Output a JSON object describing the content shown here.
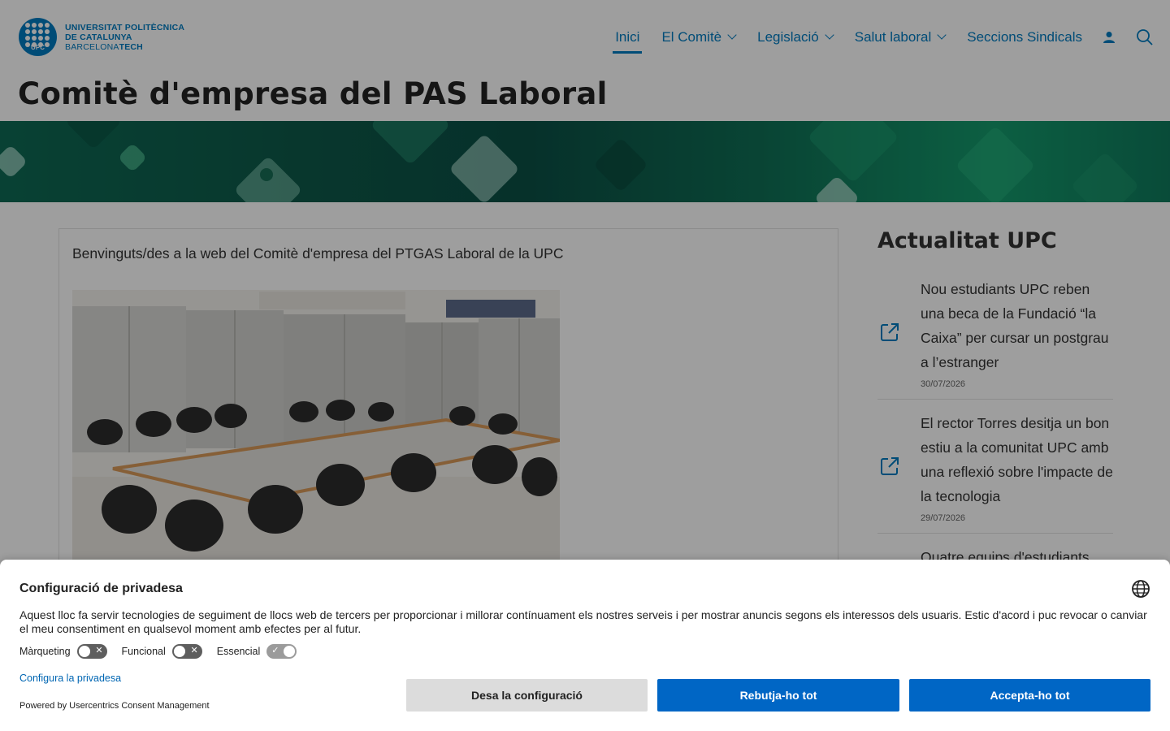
{
  "header": {
    "logo": {
      "line1": "UNIVERSITAT POLITÈCNICA",
      "line2": "DE CATALUNYA",
      "line3_light": "BARCELONA",
      "line3_bold": "TECH",
      "badge": "UPC"
    },
    "nav": [
      {
        "label": "Inici",
        "active": true,
        "dropdown": false
      },
      {
        "label": "El Comitè",
        "active": false,
        "dropdown": true
      },
      {
        "label": "Legislació",
        "active": false,
        "dropdown": true
      },
      {
        "label": "Salut laboral",
        "active": false,
        "dropdown": true
      },
      {
        "label": "Seccions Sindicals",
        "active": false,
        "dropdown": false
      }
    ],
    "icons": [
      "user-icon",
      "search-icon"
    ],
    "accent_color": "#007bc0"
  },
  "page_title": {
    "regular": "Comitè d'empresa del ",
    "bold": "PAS Laboral"
  },
  "main": {
    "intro": "Benvinguts/des a la web del Comitè d'empresa del PTGAS Laboral de la UPC"
  },
  "sidebar": {
    "title": "Actualitat UPC",
    "news": [
      {
        "title": "Nou estudiants UPC reben una beca de la Fundació “la Caixa” per cursar un postgrau a l’estranger",
        "date": "30/07/2026",
        "icon": "external-link-icon"
      },
      {
        "title": "El rector Torres desitja un bon estiu a la comunitat UPC amb una reflexió sobre l'impacte de la tecnologia",
        "date": "29/07/2026",
        "icon": "external-link-icon"
      },
      {
        "title": "Quatre equips d'estudiants",
        "date": "",
        "icon": "external-link-icon"
      }
    ]
  },
  "consent": {
    "title": "Configuració de privadesa",
    "text": "Aquest lloc fa servir tecnologies de seguiment de llocs web de tercers per proporcionar i millorar contínuament els nostres serveis i per mostrar anuncis segons els interessos dels usuaris. Estic d'acord i puc revocar o canviar el meu consentiment en qualsevol moment amb efectes per al futur.",
    "toggles": [
      {
        "label": "Màrqueting",
        "on": false
      },
      {
        "label": "Funcional",
        "on": false
      },
      {
        "label": "Essencial",
        "on": true
      }
    ],
    "configure_link": "Configura la privadesa",
    "powered_by": "Powered by Usercentrics Consent Management",
    "buttons": {
      "save": "Desa la configuració",
      "deny": "Rebutja-ho tot",
      "accept": "Accepta-ho tot"
    },
    "button_color": "#0066c5"
  }
}
